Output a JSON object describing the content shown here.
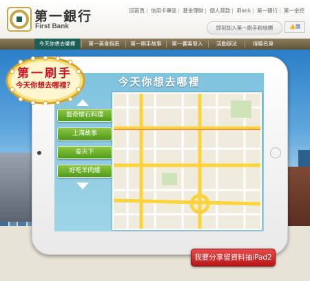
{
  "header": {
    "bank_name_zh": "第一銀行",
    "bank_name_en": "First Bank",
    "top_links": [
      "回首頁",
      "信用卡專區",
      "基金理財",
      "個人貸款",
      "iBank",
      "第一銀行",
      "第一金控"
    ],
    "fan_button": "即刻加入第一刷手粉絲團",
    "like_button": "讚"
  },
  "nav": {
    "items": [
      "今天你想去哪裡",
      "第一美食指南",
      "第一刷手故事",
      "第一饗客登入",
      "活動辦法",
      "得獎名單"
    ],
    "active_index": 0
  },
  "badge": {
    "title": "第一刷手",
    "subtitle": "今天你想去哪裡？"
  },
  "screen": {
    "title": "今天你想去哪裡",
    "options": [
      "藝奇懷石料理",
      "上海故事",
      "泰天下",
      "好吃羊肉爐"
    ]
  },
  "cta": {
    "label": "我要分享留資料抽iPad2"
  },
  "colors": {
    "nav_active": "#1c5f55",
    "option_green": "#6bb52a",
    "cta_red": "#c81e1e",
    "brand_gold": "#c7a648"
  }
}
